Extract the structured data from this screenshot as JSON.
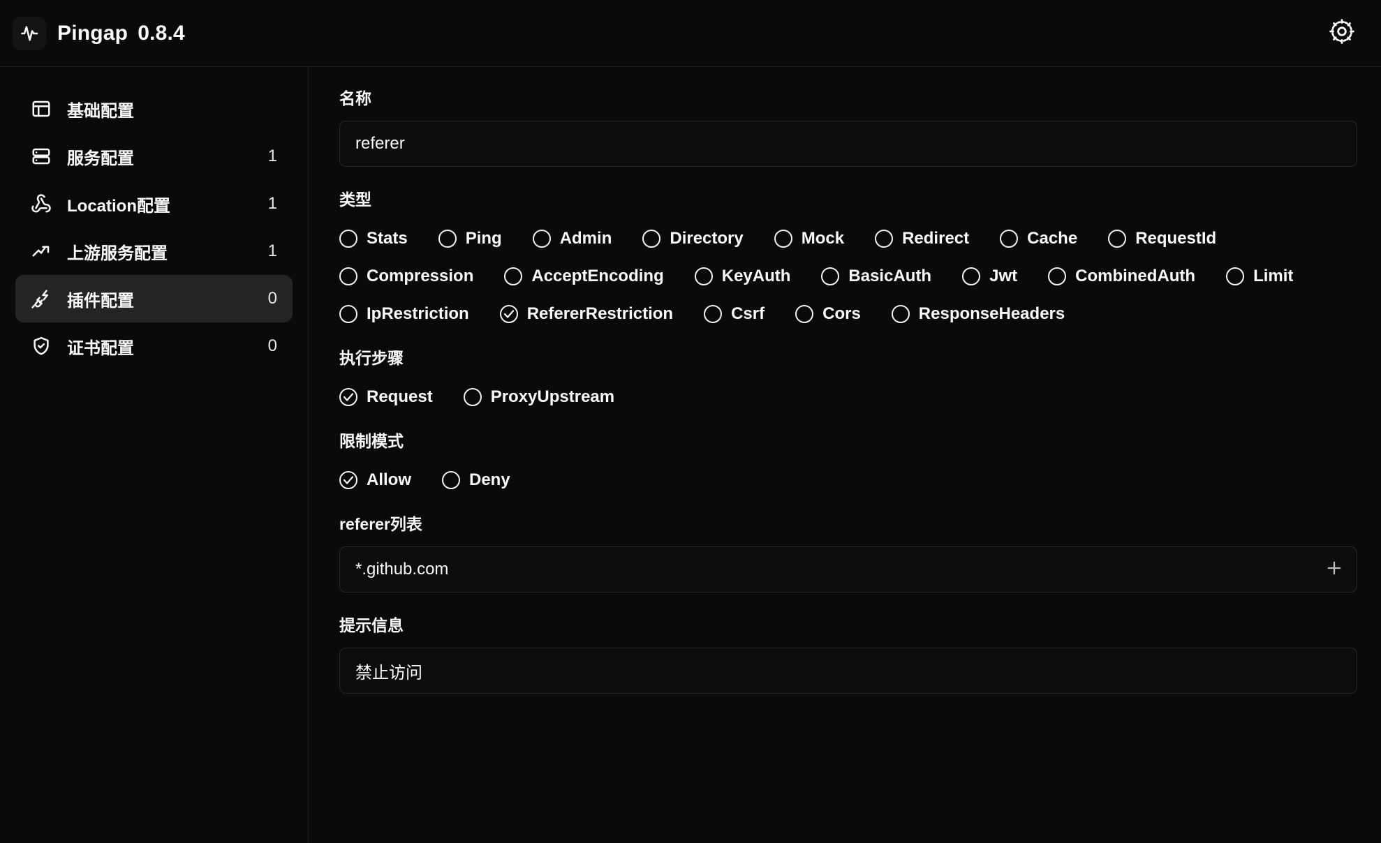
{
  "header": {
    "logo_icon": "activity-pulse-icon",
    "app_name": "Pingap",
    "version": "0.8.4",
    "settings_icon": "gear-icon"
  },
  "sidebar": {
    "items": [
      {
        "id": "basic",
        "icon": "window-layout-icon",
        "label": "基础配置",
        "count": "",
        "active": false
      },
      {
        "id": "server",
        "icon": "server-icon",
        "label": "服务配置",
        "count": "1",
        "active": false
      },
      {
        "id": "location",
        "icon": "webhook-icon",
        "label": "Location配置",
        "count": "1",
        "active": false
      },
      {
        "id": "upstream",
        "icon": "trending-up-icon",
        "label": "上游服务配置",
        "count": "1",
        "active": false
      },
      {
        "id": "plugin",
        "icon": "plug-zap-icon",
        "label": "插件配置",
        "count": "0",
        "active": true
      },
      {
        "id": "certificate",
        "icon": "shield-check-icon",
        "label": "证书配置",
        "count": "0",
        "active": false
      }
    ]
  },
  "main": {
    "name_field": {
      "label": "名称",
      "value": "referer",
      "placeholder": ""
    },
    "type_field": {
      "label": "类型",
      "options": [
        {
          "label": "Stats",
          "checked": false
        },
        {
          "label": "Ping",
          "checked": false
        },
        {
          "label": "Admin",
          "checked": false
        },
        {
          "label": "Directory",
          "checked": false
        },
        {
          "label": "Mock",
          "checked": false
        },
        {
          "label": "Redirect",
          "checked": false
        },
        {
          "label": "Cache",
          "checked": false
        },
        {
          "label": "RequestId",
          "checked": false
        },
        {
          "label": "Compression",
          "checked": false
        },
        {
          "label": "AcceptEncoding",
          "checked": false
        },
        {
          "label": "KeyAuth",
          "checked": false
        },
        {
          "label": "BasicAuth",
          "checked": false
        },
        {
          "label": "Jwt",
          "checked": false
        },
        {
          "label": "CombinedAuth",
          "checked": false
        },
        {
          "label": "Limit",
          "checked": false
        },
        {
          "label": "IpRestriction",
          "checked": false
        },
        {
          "label": "RefererRestriction",
          "checked": true
        },
        {
          "label": "Csrf",
          "checked": false
        },
        {
          "label": "Cors",
          "checked": false
        },
        {
          "label": "ResponseHeaders",
          "checked": false
        }
      ]
    },
    "step_field": {
      "label": "执行步骤",
      "options": [
        {
          "label": "Request",
          "checked": true
        },
        {
          "label": "ProxyUpstream",
          "checked": false
        }
      ]
    },
    "mode_field": {
      "label": "限制模式",
      "options": [
        {
          "label": "Allow",
          "checked": true
        },
        {
          "label": "Deny",
          "checked": false
        }
      ]
    },
    "referer_list_field": {
      "label": "referer列表",
      "value": "*.github.com",
      "add_icon": "plus-icon"
    },
    "message_field": {
      "label": "提示信息",
      "value": "禁止访问"
    }
  },
  "colors": {
    "background": "#0a0a0a",
    "panel": "#0d0d0d",
    "border": "#272727",
    "active_nav": "#242424",
    "text": "#fafafa"
  }
}
